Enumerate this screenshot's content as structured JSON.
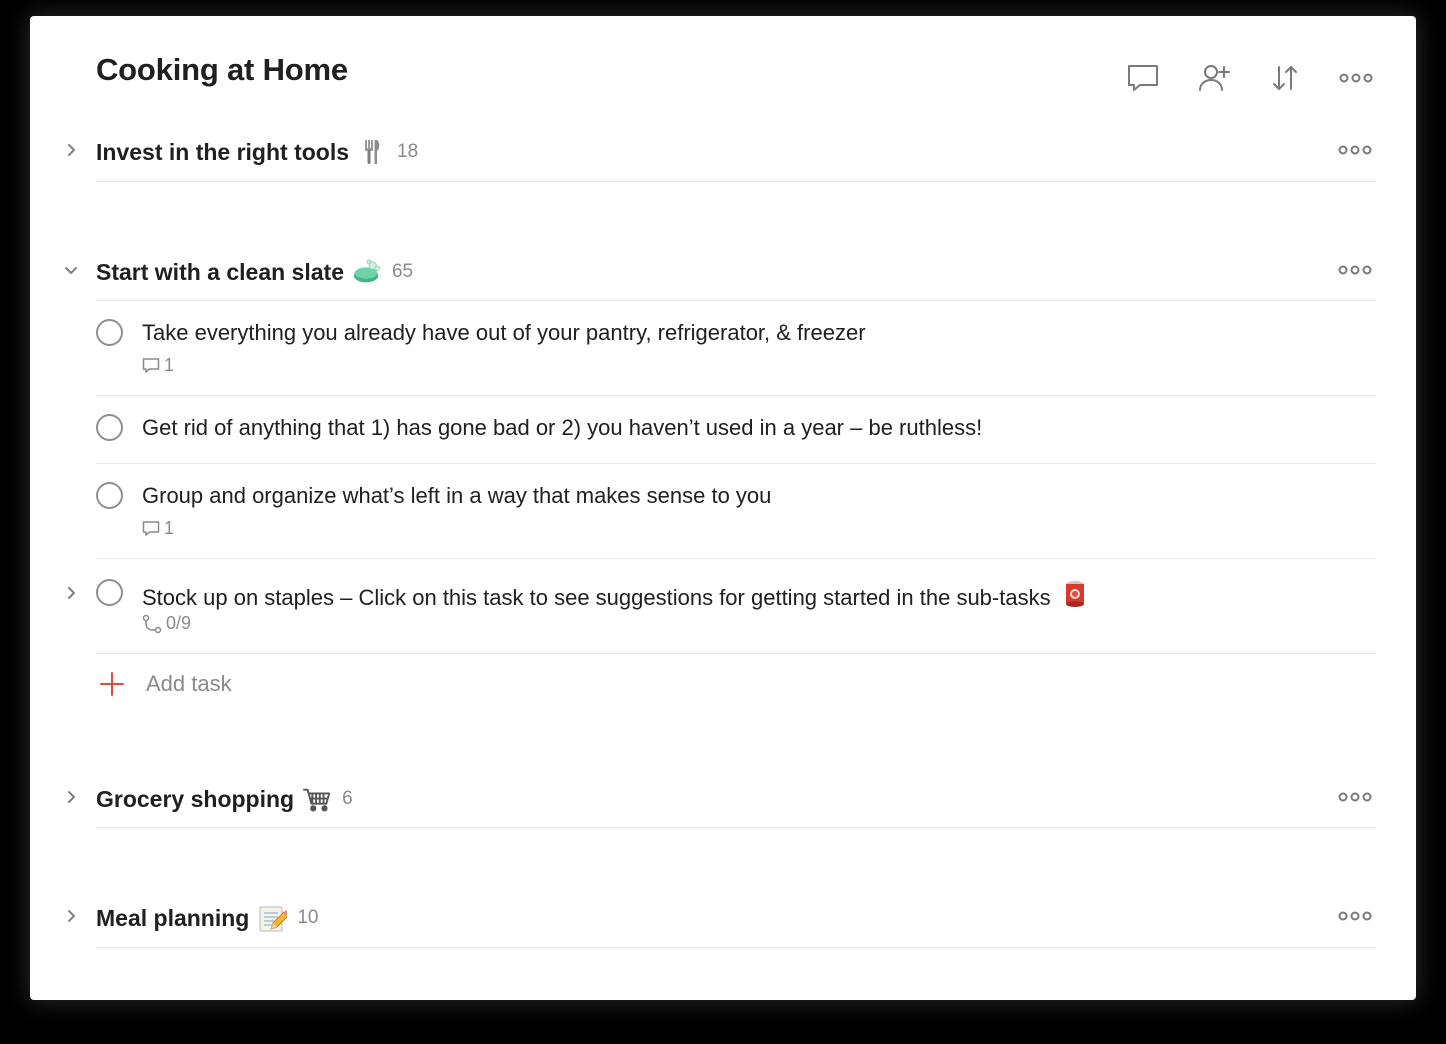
{
  "project": {
    "title": "Cooking at Home"
  },
  "header": {
    "actions": [
      {
        "icon": "comment-icon"
      },
      {
        "icon": "add-person-icon"
      },
      {
        "icon": "sort-icon"
      },
      {
        "icon": "more-icon"
      }
    ]
  },
  "sections": [
    {
      "name": "Invest in the right tools",
      "emoji": "fork-and-knife",
      "count": "18",
      "expanded": false
    },
    {
      "name": "Start with a clean slate",
      "emoji": "soap",
      "count": "65",
      "expanded": true
    },
    {
      "name": "Grocery shopping",
      "emoji": "shopping-cart",
      "count": "6",
      "expanded": false
    },
    {
      "name": "Meal planning",
      "emoji": "memo",
      "count": "10",
      "expanded": false
    }
  ],
  "tasks": [
    {
      "text": "Take everything you already have out of your pantry, refrigerator, & freezer",
      "comments": "1"
    },
    {
      "text": "Get rid of anything that 1) has gone bad or 2) you haven’t used in a year – be ruthless!"
    },
    {
      "text": "Group and organize what’s left in a way that makes sense to you",
      "comments": "1"
    },
    {
      "text": "Stock up on staples – Click on this task to see suggestions for getting started in the sub-tasks",
      "emoji": "canned-food",
      "subtasks": "0/9"
    }
  ],
  "add_task": {
    "label": "Add task"
  },
  "colors": {
    "accent": "#dc4c3e",
    "text": "#202020",
    "muted": "#8a8a8a",
    "divider": "#e8e8e8"
  }
}
